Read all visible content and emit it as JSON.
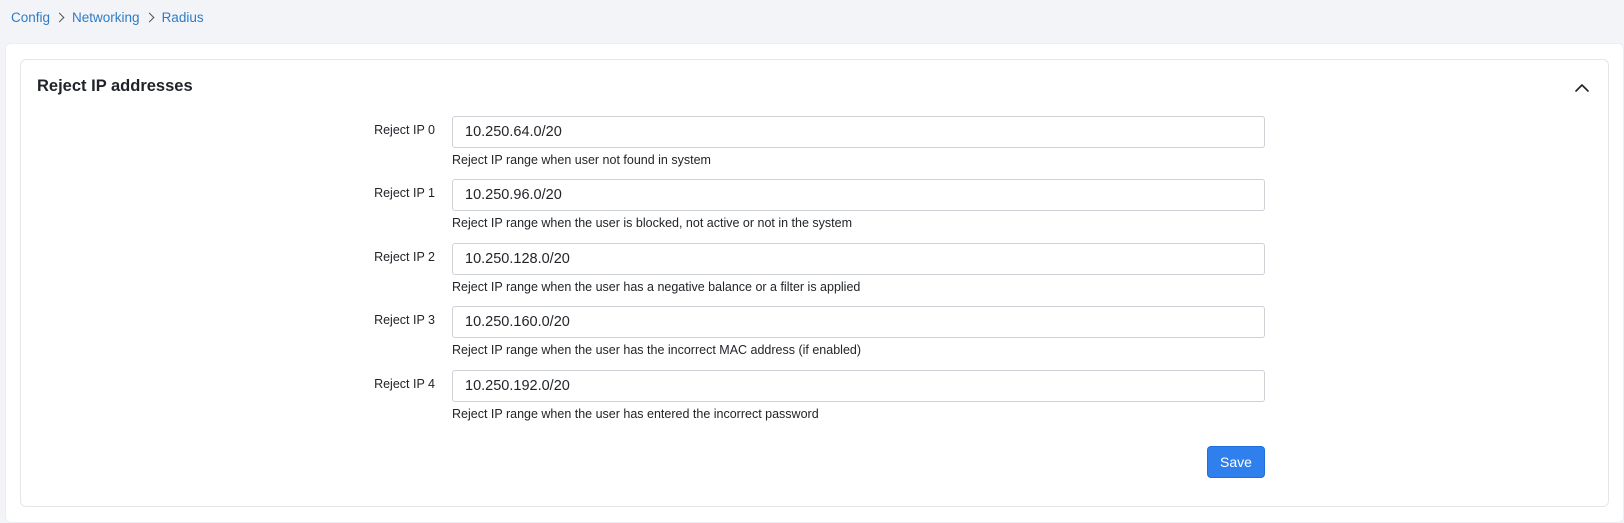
{
  "breadcrumb": {
    "items": [
      "Config",
      "Networking",
      "Radius"
    ]
  },
  "card": {
    "title": "Reject IP addresses",
    "collapse_icon": "chevron-up-icon"
  },
  "rows": [
    {
      "label": "Reject IP 0",
      "value": "10.250.64.0/20",
      "help": "Reject IP range when user not found in system"
    },
    {
      "label": "Reject IP 1",
      "value": "10.250.96.0/20",
      "help": "Reject IP range when the user is blocked, not active or not in the system"
    },
    {
      "label": "Reject IP 2",
      "value": "10.250.128.0/20",
      "help": "Reject IP range when the user has a negative balance or a filter is applied"
    },
    {
      "label": "Reject IP 3",
      "value": "10.250.160.0/20",
      "help": "Reject IP range when the user has the incorrect MAC address (if enabled)"
    },
    {
      "label": "Reject IP 4",
      "value": "10.250.192.0/20",
      "help": "Reject IP range when the user has entered the incorrect password"
    }
  ],
  "actions": {
    "save_label": "Save"
  },
  "colors": {
    "link": "#2f7cc4",
    "primary_button": "#2f80ed",
    "page_background": "#f3f4f8"
  }
}
